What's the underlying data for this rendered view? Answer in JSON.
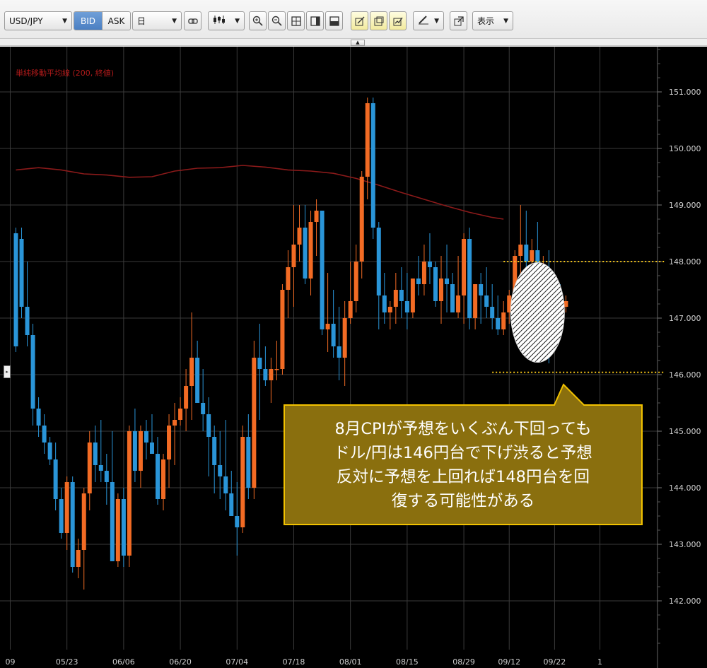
{
  "toolbar": {
    "symbol": "USD/JPY",
    "bid_label": "BID",
    "ask_label": "ASK",
    "timeframe": "日",
    "view_label": "表示",
    "icons": [
      "link-icon",
      "candlestick-type-icon",
      "zoom-in-icon",
      "zoom-out-icon",
      "grid-layout-icon",
      "panel-right-icon",
      "panel-split-icon",
      "draw-tool-1-icon",
      "draw-tool-2-icon",
      "draw-tool-3-icon",
      "pen-icon",
      "popout-icon"
    ]
  },
  "colors": {
    "background": "#000000",
    "up_candle": "#f26b24",
    "down_candle": "#2a95d8",
    "ma_line": "#8b1a1a",
    "grid": "#3a3a3a",
    "guide_line": "#f5c518",
    "callout_fill": "#8a6f0e",
    "callout_border": "#f2c200"
  },
  "chart_data": {
    "type": "candlestick",
    "indicator_label": "単純移動平均線 (200, 終値)",
    "ylim": [
      141.1,
      151.9
    ],
    "y_ticks": [
      {
        "value": 151,
        "label": "151.000"
      },
      {
        "value": 150,
        "label": "150.000"
      },
      {
        "value": 149,
        "label": "149.000"
      },
      {
        "value": 148,
        "label": "148.000"
      },
      {
        "value": 147,
        "label": "147.000"
      },
      {
        "value": 146,
        "label": "146.000"
      },
      {
        "value": 145,
        "label": "145.000"
      },
      {
        "value": 144,
        "label": "144.000"
      },
      {
        "value": 143,
        "label": "143.000"
      },
      {
        "value": 142,
        "label": "142.000"
      }
    ],
    "x_ticks": [
      {
        "index": -1,
        "label": "09"
      },
      {
        "index": 9,
        "label": "05/23"
      },
      {
        "index": 19,
        "label": "06/06"
      },
      {
        "index": 29,
        "label": "06/20"
      },
      {
        "index": 39,
        "label": "07/04"
      },
      {
        "index": 49,
        "label": "07/18"
      },
      {
        "index": 59,
        "label": "08/01"
      },
      {
        "index": 69,
        "label": "08/15"
      },
      {
        "index": 79,
        "label": "08/29"
      },
      {
        "index": 87,
        "label": "09/12"
      },
      {
        "index": 95,
        "label": "09/22"
      },
      {
        "index": 103,
        "label": "1"
      }
    ],
    "candles": [
      [
        148.5,
        148.6,
        146.4,
        146.5
      ],
      [
        148.4,
        148.6,
        147.0,
        147.2
      ],
      [
        147.2,
        148.0,
        146.5,
        146.7
      ],
      [
        146.7,
        146.9,
        145.1,
        145.4
      ],
      [
        145.4,
        145.6,
        144.9,
        145.1
      ],
      [
        145.1,
        145.3,
        144.6,
        144.8
      ],
      [
        144.8,
        144.9,
        144.4,
        144.5
      ],
      [
        144.5,
        144.8,
        143.6,
        143.8
      ],
      [
        143.8,
        144.0,
        143.1,
        143.2
      ],
      [
        143.2,
        144.2,
        142.9,
        144.1
      ],
      [
        144.1,
        144.2,
        142.5,
        142.6
      ],
      [
        142.6,
        143.1,
        142.4,
        142.9
      ],
      [
        142.9,
        144.0,
        142.2,
        143.9
      ],
      [
        143.9,
        145.0,
        143.6,
        144.8
      ],
      [
        144.8,
        145.1,
        144.1,
        144.4
      ],
      [
        144.4,
        145.2,
        144.1,
        144.3
      ],
      [
        144.3,
        144.6,
        143.7,
        144.1
      ],
      [
        144.1,
        145.0,
        142.8,
        142.7
      ],
      [
        142.7,
        143.9,
        142.6,
        143.8
      ],
      [
        143.8,
        144.0,
        142.6,
        142.8
      ],
      [
        142.8,
        145.1,
        142.6,
        145.0
      ],
      [
        145.0,
        145.4,
        144.1,
        144.3
      ],
      [
        144.3,
        145.1,
        144.0,
        145.0
      ],
      [
        145.0,
        145.2,
        144.5,
        144.8
      ],
      [
        144.8,
        145.3,
        144.6,
        144.6
      ],
      [
        144.6,
        144.9,
        143.7,
        143.8
      ],
      [
        143.8,
        144.6,
        143.6,
        144.5
      ],
      [
        144.5,
        145.3,
        144.0,
        145.1
      ],
      [
        145.1,
        145.5,
        144.4,
        145.2
      ],
      [
        145.2,
        145.6,
        145.1,
        145.4
      ],
      [
        145.4,
        146.1,
        145.0,
        145.8
      ],
      [
        145.8,
        147.1,
        145.2,
        146.3
      ],
      [
        146.3,
        146.6,
        145.6,
        145.5
      ],
      [
        145.5,
        146.1,
        145.0,
        145.3
      ],
      [
        145.3,
        145.6,
        144.2,
        144.9
      ],
      [
        144.9,
        145.1,
        143.9,
        144.4
      ],
      [
        144.4,
        145.0,
        143.8,
        144.2
      ],
      [
        144.2,
        145.2,
        143.6,
        143.9
      ],
      [
        143.9,
        144.3,
        143.5,
        143.5
      ],
      [
        143.5,
        144.1,
        142.8,
        143.3
      ],
      [
        143.3,
        145.1,
        143.2,
        144.9
      ],
      [
        144.9,
        145.3,
        143.8,
        144.0
      ],
      [
        144.0,
        146.6,
        143.8,
        146.3
      ],
      [
        146.3,
        146.9,
        145.2,
        146.1
      ],
      [
        146.1,
        146.5,
        145.8,
        145.9
      ],
      [
        145.9,
        146.3,
        145.5,
        146.1
      ],
      [
        146.1,
        146.6,
        145.9,
        146.1
      ],
      [
        146.1,
        147.6,
        146.0,
        147.5
      ],
      [
        147.5,
        148.2,
        147.0,
        147.9
      ],
      [
        147.9,
        149.0,
        147.2,
        148.3
      ],
      [
        148.3,
        149.0,
        148.0,
        148.6
      ],
      [
        148.6,
        149.0,
        147.6,
        147.7
      ],
      [
        147.7,
        148.9,
        147.4,
        148.7
      ],
      [
        148.7,
        149.1,
        148.1,
        148.9
      ],
      [
        148.9,
        148.9,
        146.7,
        146.8
      ],
      [
        146.8,
        147.8,
        146.4,
        146.9
      ],
      [
        146.9,
        147.5,
        146.3,
        146.5
      ],
      [
        146.5,
        147.2,
        145.9,
        146.3
      ],
      [
        146.3,
        147.3,
        145.8,
        147.0
      ],
      [
        147.0,
        148.0,
        146.9,
        147.3
      ],
      [
        147.3,
        148.3,
        147.1,
        148.0
      ],
      [
        148.0,
        149.6,
        147.7,
        149.5
      ],
      [
        149.5,
        150.9,
        149.1,
        150.8
      ],
      [
        150.8,
        150.9,
        148.4,
        148.6
      ],
      [
        148.6,
        148.7,
        146.8,
        147.4
      ],
      [
        147.4,
        147.8,
        146.9,
        147.1
      ],
      [
        147.1,
        147.3,
        146.8,
        147.2
      ],
      [
        147.2,
        147.8,
        146.9,
        147.5
      ],
      [
        147.5,
        147.9,
        147.0,
        147.3
      ],
      [
        147.3,
        147.8,
        146.8,
        147.1
      ],
      [
        147.1,
        147.7,
        147.0,
        147.7
      ],
      [
        147.7,
        148.1,
        147.4,
        147.6
      ],
      [
        147.6,
        148.3,
        147.4,
        148.0
      ],
      [
        148.0,
        148.5,
        147.6,
        147.9
      ],
      [
        147.9,
        148.0,
        147.2,
        147.3
      ],
      [
        147.3,
        148.1,
        146.9,
        147.7
      ],
      [
        147.7,
        148.3,
        147.1,
        147.6
      ],
      [
        147.6,
        147.8,
        147.2,
        147.1
      ],
      [
        147.1,
        148.1,
        147.0,
        147.4
      ],
      [
        147.4,
        148.5,
        146.9,
        148.4
      ],
      [
        148.4,
        148.6,
        146.8,
        147.0
      ],
      [
        147.0,
        147.6,
        146.8,
        147.6
      ],
      [
        147.6,
        147.8,
        146.9,
        147.4
      ],
      [
        147.4,
        147.9,
        147.0,
        147.2
      ],
      [
        147.2,
        147.6,
        146.8,
        147.0
      ],
      [
        147.0,
        147.4,
        146.7,
        146.8
      ],
      [
        146.8,
        147.3,
        146.7,
        147.1
      ],
      [
        147.1,
        147.5,
        146.9,
        147.4
      ],
      [
        147.4,
        148.2,
        147.1,
        148.1
      ],
      [
        148.1,
        149.0,
        147.4,
        148.3
      ],
      [
        148.3,
        148.9,
        147.8,
        148.0
      ],
      [
        148.0,
        148.4,
        147.9,
        148.2
      ],
      [
        148.2,
        148.7,
        147.2,
        147.4
      ],
      [
        147.4,
        148.1,
        146.8,
        147.8
      ],
      [
        147.8,
        148.2,
        146.2,
        146.9
      ],
      [
        146.9,
        147.5,
        147.3,
        147.4
      ],
      [
        147.4,
        147.6,
        147.1,
        147.2
      ],
      [
        147.2,
        147.4,
        147.1,
        147.3
      ]
    ],
    "ma200": [
      [
        0,
        149.62
      ],
      [
        4,
        149.66
      ],
      [
        8,
        149.62
      ],
      [
        12,
        149.55
      ],
      [
        16,
        149.53
      ],
      [
        20,
        149.49
      ],
      [
        24,
        149.5
      ],
      [
        28,
        149.6
      ],
      [
        32,
        149.65
      ],
      [
        36,
        149.66
      ],
      [
        40,
        149.7
      ],
      [
        44,
        149.67
      ],
      [
        48,
        149.62
      ],
      [
        52,
        149.6
      ],
      [
        56,
        149.56
      ],
      [
        60,
        149.47
      ],
      [
        64,
        149.35
      ],
      [
        68,
        149.22
      ],
      [
        72,
        149.1
      ],
      [
        76,
        148.98
      ],
      [
        80,
        148.87
      ],
      [
        84,
        148.78
      ],
      [
        86,
        148.75
      ]
    ],
    "guide_lines": [
      {
        "value": 148.0,
        "from_index": 86
      },
      {
        "value": 146.04,
        "from_index": 84
      }
    ],
    "forecast_zone": {
      "index_center": 92,
      "y_low": 146.2,
      "y_high": 148.0
    },
    "annotation": {
      "lines": [
        "8月CPIが予想をいくぶん下回っても",
        "ドル/円は146円台で下げ渋ると予想",
        "反対に予想を上回れば148円台を回",
        "復する可能性がある"
      ]
    }
  }
}
